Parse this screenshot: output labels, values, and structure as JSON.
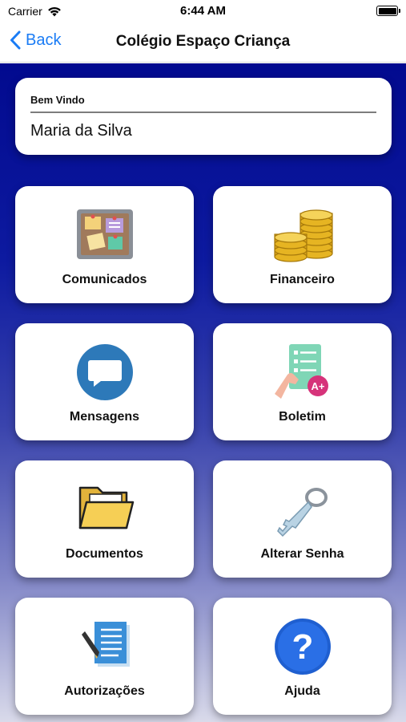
{
  "status_bar": {
    "carrier": "Carrier",
    "time": "6:44 AM"
  },
  "nav": {
    "back_label": "Back",
    "title": "Colégio Espaço Criança"
  },
  "welcome": {
    "label": "Bem Vindo",
    "name": "Maria da Silva"
  },
  "tiles": [
    {
      "label": "Comunicados",
      "icon": "bulletin-board-icon"
    },
    {
      "label": "Financeiro",
      "icon": "gold-coins-icon"
    },
    {
      "label": "Mensagens",
      "icon": "chat-bubble-icon"
    },
    {
      "label": "Boletim",
      "icon": "report-card-icon"
    },
    {
      "label": "Documentos",
      "icon": "folder-icon"
    },
    {
      "label": "Alterar Senha",
      "icon": "key-icon"
    },
    {
      "label": "Autorizações",
      "icon": "signed-document-icon"
    },
    {
      "label": "Ajuda",
      "icon": "help-icon"
    }
  ],
  "colors": {
    "accent": "#1a7cf5",
    "background_top": "#020a8f",
    "background_bottom": "#d9daea"
  }
}
